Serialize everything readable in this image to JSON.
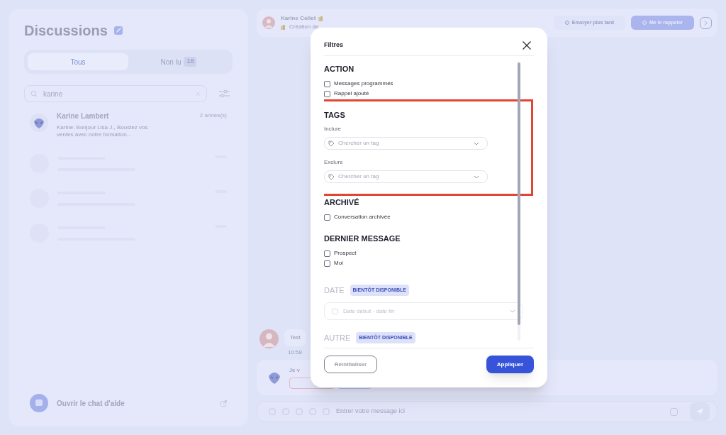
{
  "sidebar": {
    "title": "Discussions",
    "tabs": [
      {
        "label": "Tous",
        "selected": true
      },
      {
        "label": "Non lu",
        "badge": "18",
        "selected": false
      }
    ],
    "search": {
      "value": "karine"
    },
    "conversations": [
      {
        "name": "Karine Lambert",
        "preview": "Karine: Bonjour Lisa J., Boostez vos ventes avec notre formation...",
        "time": "2 année(s)"
      }
    ],
    "loading": true,
    "help": {
      "label": "Ouvrir le chat d'aide"
    }
  },
  "chat": {
    "contact": {
      "name": "Karine Collet",
      "subtitle": "Création de"
    },
    "actions": [
      {
        "label": "Envoyer plus tard",
        "kind": "secondary"
      },
      {
        "label": "Me le rappeler",
        "kind": "primary"
      }
    ],
    "messages": [
      {
        "kind": "sent",
        "text": "Test",
        "time": "10:58"
      },
      {
        "kind": "bot",
        "text": "Je v"
      }
    ],
    "composer": {
      "placeholder": "Entrer votre message ici"
    }
  },
  "modal": {
    "title": "Filtres",
    "sections": [
      {
        "kind": "checks",
        "title": "ACTION",
        "options": [
          {
            "label": "Messages programmés",
            "checked": false
          },
          {
            "label": "Rappel ajouté",
            "checked": false
          }
        ]
      },
      {
        "kind": "tags",
        "title": "TAGS",
        "highlighted": true,
        "fields": [
          {
            "label": "Inclure",
            "placeholder": "Chercher un tag"
          },
          {
            "label": "Exclure",
            "placeholder": "Chercher un tag"
          }
        ]
      },
      {
        "kind": "checks",
        "title": "ARCHIVÉ",
        "options": [
          {
            "label": "Conversation archivée",
            "checked": false
          }
        ]
      },
      {
        "kind": "checks",
        "title": "DERNIER MESSAGE",
        "options": [
          {
            "label": "Prospect",
            "checked": false
          },
          {
            "label": "Moi",
            "checked": false
          }
        ]
      },
      {
        "kind": "date",
        "title": "DATE",
        "disabled": true,
        "badge": "BIENTÔT DISPONIBLE",
        "placeholder": "Date début - date fin"
      },
      {
        "kind": "other",
        "title": "AUTRE",
        "disabled": true,
        "badge": "BIENTÔT DISPONIBLE"
      }
    ],
    "reset": "Réinitialiser",
    "apply": "Appliquer"
  }
}
